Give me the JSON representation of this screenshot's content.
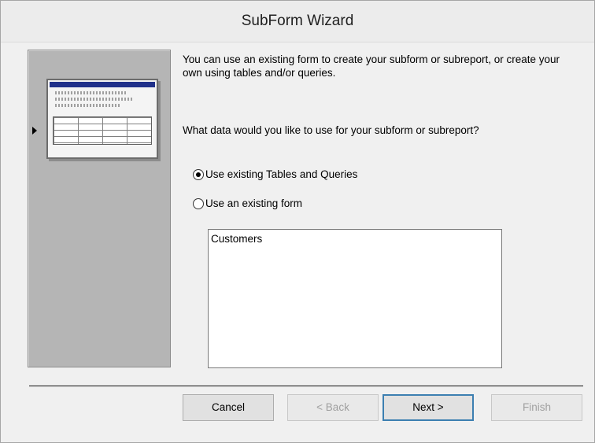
{
  "window": {
    "title": "SubForm Wizard"
  },
  "content": {
    "intro": "You can use an existing form to create your subform or subreport, or create your own using tables and/or queries.",
    "question": "What data would you like to use for your subform or subreport?"
  },
  "options": [
    {
      "label": "Use existing Tables and Queries",
      "selected": true
    },
    {
      "label": "Use an existing form",
      "selected": false
    }
  ],
  "form_list": {
    "items": [
      "Customers"
    ]
  },
  "buttons": {
    "cancel": "Cancel",
    "back": "< Back",
    "next": "Next >",
    "finish": "Finish"
  },
  "icons": {
    "preview": "form-preview-icon",
    "pointer": "pointer-arrow-icon"
  }
}
